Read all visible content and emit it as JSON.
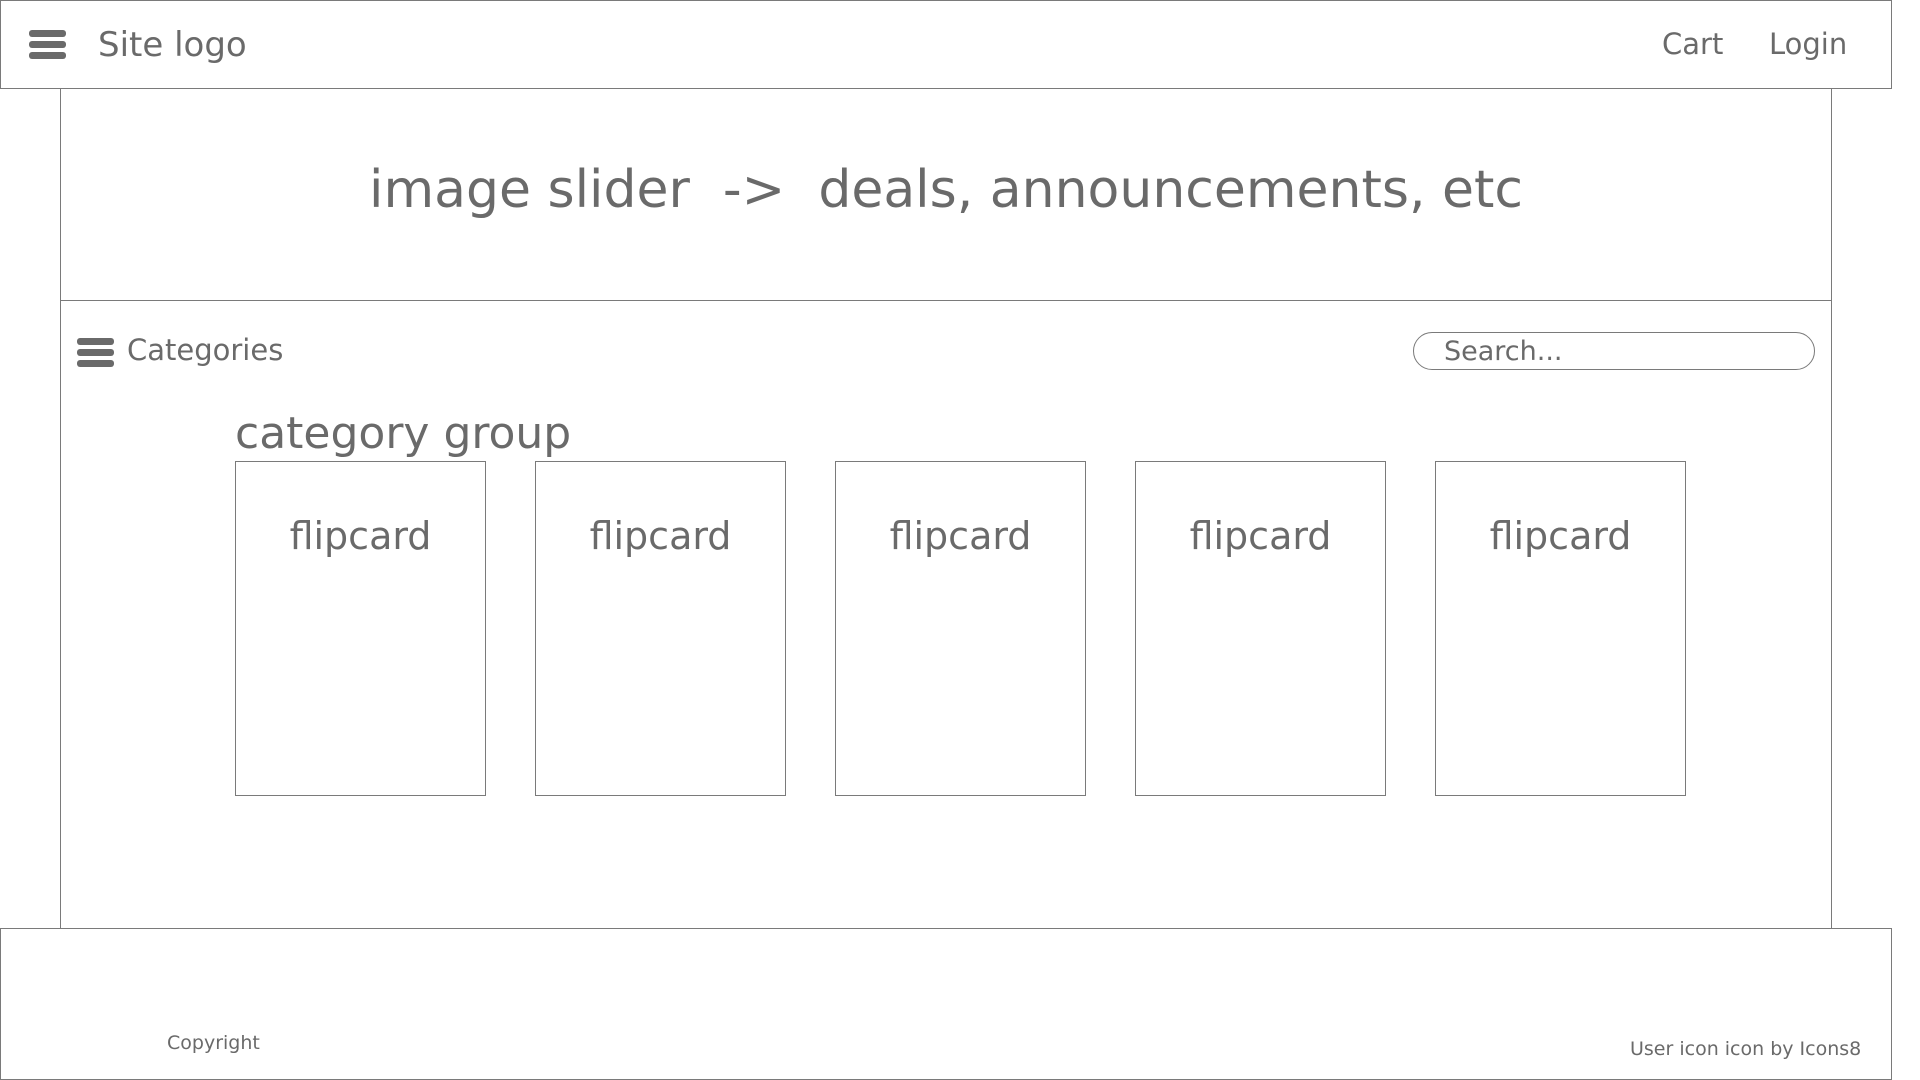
{
  "header": {
    "logo": "Site logo",
    "menu_icon": "hamburger-menu-icon",
    "cart": "Cart",
    "login": "Login"
  },
  "hero": {
    "text": "image slider  ->  deals, announcements, etc"
  },
  "toolbar": {
    "categories_icon": "hamburger-menu-icon",
    "categories_label": "Categories",
    "search_placeholder": "Search..."
  },
  "category_group": {
    "title": "category group",
    "cards": [
      "flipcard",
      "flipcard",
      "flipcard",
      "flipcard",
      "flipcard"
    ]
  },
  "footer": {
    "copyright": "Copyright",
    "credit": "User icon icon by Icons8"
  }
}
